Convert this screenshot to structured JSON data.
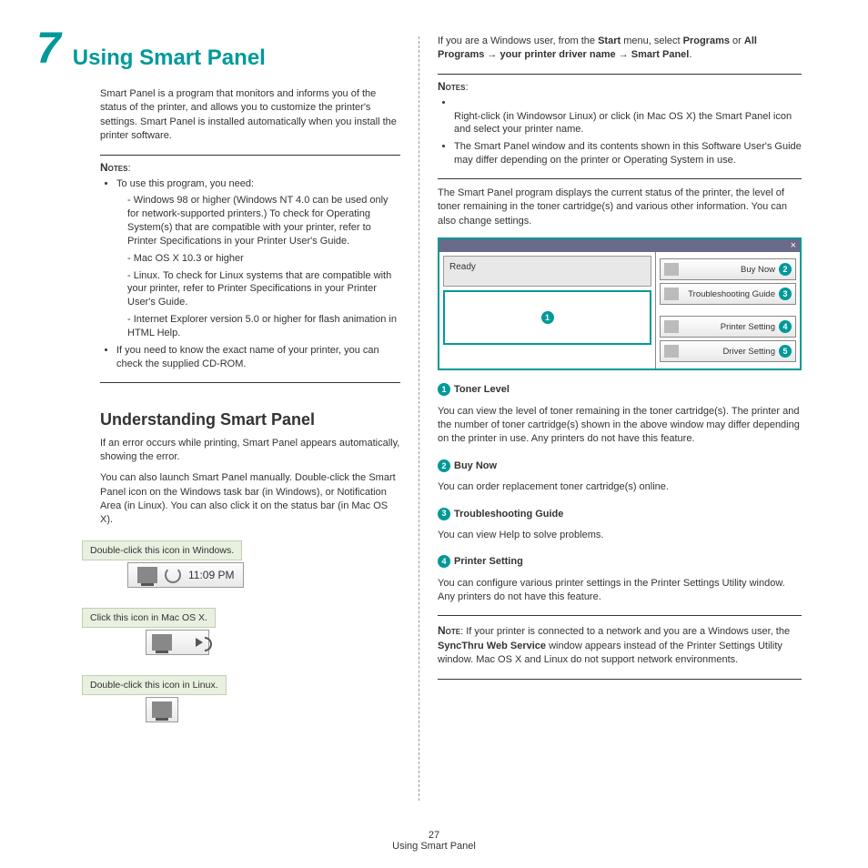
{
  "chapter_number": "7",
  "title": "Using Smart Panel",
  "intro": "Smart Panel is a program that monitors and informs you of the status of the printer, and allows you to customize the printer's settings. Smart Panel is installed automatically when you install the printer software.",
  "notes_label": "Notes",
  "note_label": "Note",
  "notes1_lead": "To use this program, you need:",
  "notes1_items": [
    "Windows 98 or higher (Windows NT 4.0 can be used only for network-supported printers.) To check for Operating System(s) that are compatible with your printer, refer to Printer Specifications in your Printer User's Guide.",
    "Mac OS X 10.3 or higher",
    "Linux. To check for Linux systems that are compatible with your printer, refer to Printer Specifications in your Printer User's Guide.",
    "Internet Explorer version 5.0 or higher for flash animation in HTML Help."
  ],
  "notes1_tail": "If you need to know the exact name of your printer, you can check the supplied CD-ROM.",
  "h2": "Understanding Smart Panel",
  "p_error": "If an error occurs while printing, Smart Panel appears automatically, showing the error.",
  "p_launch": "You can also launch Smart Panel manually. Double-click the Smart Panel icon on the Windows task bar (in Windows), or Notification Area (in Linux). You can also click it on the status bar (in Mac OS X).",
  "callouts": {
    "win": "Double-click this icon in Windows.",
    "mac": "Click this icon in Mac OS X.",
    "lin": "Double-click this icon in Linux."
  },
  "time": "11:09 PM",
  "right_intro": {
    "line1a": "If you are a Windows user, from the ",
    "start": "Start",
    "line1b": " menu, select ",
    "programs": "Programs",
    "or": " or ",
    "allprograms": "All Programs",
    "arrow": " → ",
    "driver": "your printer driver name",
    "smartpanel": "Smart Panel",
    "period": "."
  },
  "notes2_items": [
    "Right-click (in Windowsor Linux) or click (in Mac OS X) the Smart Panel icon and select your printer name.",
    "The Smart Panel window and its contents shown in this Software User's Guide may differ depending on the printer or Operating System in use."
  ],
  "p_display": "The Smart Panel program displays the current status of the printer, the level of toner remaining in the toner cartridge(s) and various other information. You can also change settings.",
  "panel": {
    "ready": "Ready",
    "close": "×",
    "buttons": [
      "Buy Now",
      "Troubleshooting Guide",
      "Printer Setting",
      "Driver Setting"
    ],
    "nums": [
      "1",
      "2",
      "3",
      "4",
      "5"
    ]
  },
  "features": [
    {
      "num": "1",
      "title": "Toner Level",
      "body": "You can view the level of toner remaining in the toner cartridge(s). The printer and the number of toner cartridge(s) shown in the above window may differ depending on the printer in use. Any printers do not have this feature."
    },
    {
      "num": "2",
      "title": "Buy Now",
      "body": "You can order replacement toner cartridge(s) online."
    },
    {
      "num": "3",
      "title": "Troubleshooting Guide",
      "body": "You can view Help to solve problems."
    },
    {
      "num": "4",
      "title": "Printer Setting",
      "body": "You can configure various printer settings in the Printer Settings Utility window. Any printers do not have this feature."
    }
  ],
  "note_network": {
    "pre": ": If your printer is connected to a network and you are a Windows user, the ",
    "bold": "SyncThru Web Service",
    "post": " window appears instead of the Printer Settings Utility window. Mac OS X and Linux do not support network environments."
  },
  "footer_num": "27",
  "footer_text": "Using Smart Panel"
}
